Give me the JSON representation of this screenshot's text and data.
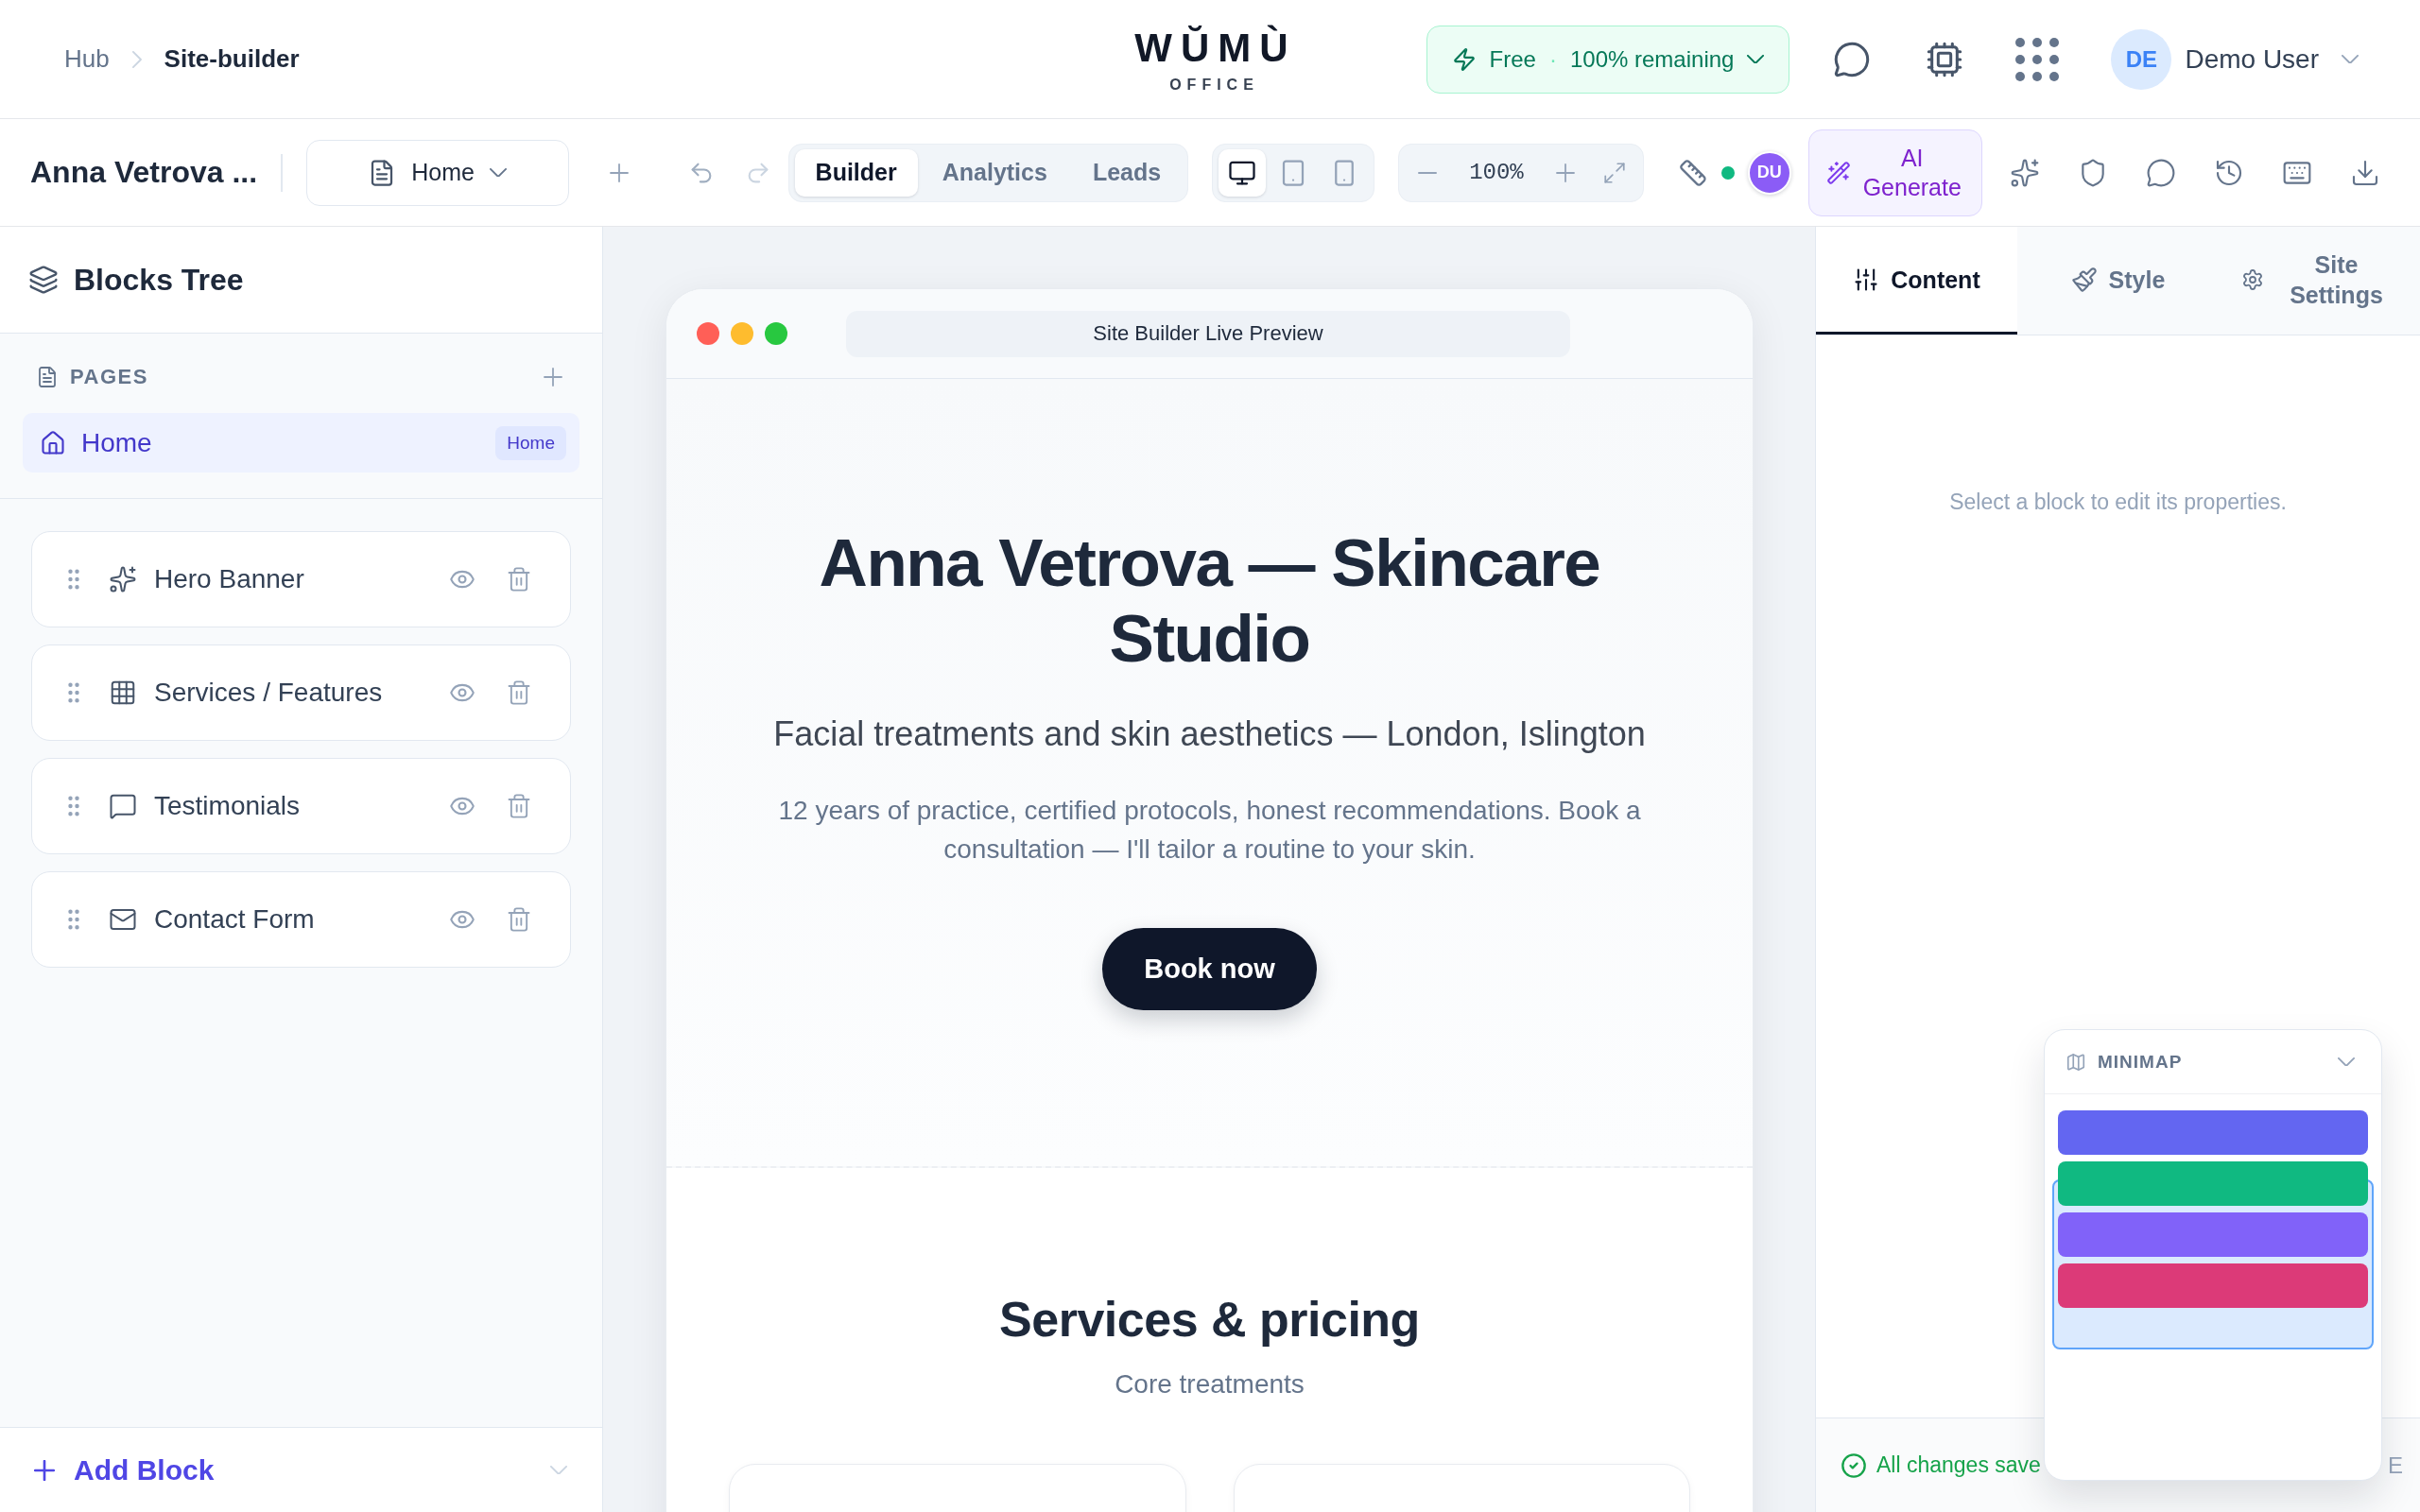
{
  "topbar": {
    "breadcrumb": [
      {
        "label": "Hub",
        "current": false
      },
      {
        "label": "Site-builder",
        "current": true
      }
    ],
    "logo": {
      "wordmark": "WŬMÙ",
      "tagline": "OFFICE"
    },
    "plan": {
      "tier": "Free",
      "separator": "·",
      "remaining": "100% remaining"
    },
    "user": {
      "initials": "DE",
      "name": "Demo User"
    }
  },
  "toolbar": {
    "site_name": "Anna Vetrova ...",
    "page_select": "Home",
    "modes": [
      {
        "label": "Builder",
        "selected": true
      },
      {
        "label": "Analytics",
        "selected": false
      },
      {
        "label": "Leads",
        "selected": false
      }
    ],
    "devices": [
      {
        "kind": "desktop",
        "selected": true
      },
      {
        "kind": "tablet",
        "selected": false
      },
      {
        "kind": "phone",
        "selected": false
      }
    ],
    "zoom": "100%",
    "collaborator": {
      "initials": "DU",
      "online": true
    },
    "ai_button": "AI Generate"
  },
  "sidebar": {
    "title": "Blocks Tree",
    "pages_label": "PAGES",
    "pages": [
      {
        "name": "Home",
        "badge": "Home",
        "selected": true
      }
    ],
    "blocks": [
      {
        "kind": "hero",
        "label": "Hero Banner",
        "visible": true
      },
      {
        "kind": "features",
        "label": "Services / Features",
        "visible": true
      },
      {
        "kind": "testimonials",
        "label": "Testimonials",
        "visible": true
      },
      {
        "kind": "contact",
        "label": "Contact Form",
        "visible": true
      }
    ],
    "add_block": "Add Block"
  },
  "preview": {
    "address": "Site Builder Live Preview",
    "hero": {
      "title": "Anna Vetrova — Skincare Studio",
      "subtitle": "Facial treatments and skin aesthetics — London, Islington",
      "description": "12 years of practice, certified protocols, honest recommendations. Book a consultation — I'll tailor a routine to your skin.",
      "cta": "Book now"
    },
    "services": {
      "title": "Services & pricing",
      "subtitle": "Core treatments"
    }
  },
  "inspector": {
    "tabs": [
      {
        "kind": "content",
        "label": "Content",
        "selected": true
      },
      {
        "kind": "style",
        "label": "Style",
        "selected": false
      },
      {
        "kind": "settings",
        "label": "Site Settings",
        "selected": false
      }
    ],
    "empty_message": "Select a block to edit its properties."
  },
  "status_bar": {
    "saved": "All changes save",
    "trailing": "E"
  },
  "minimap": {
    "title": "MINIMAP",
    "expanded": true,
    "blocks": [
      {
        "color": "#6366f1"
      },
      {
        "color": "#10b981"
      },
      {
        "color": "#8162f9"
      },
      {
        "color": "#dc3a78"
      }
    ]
  }
}
